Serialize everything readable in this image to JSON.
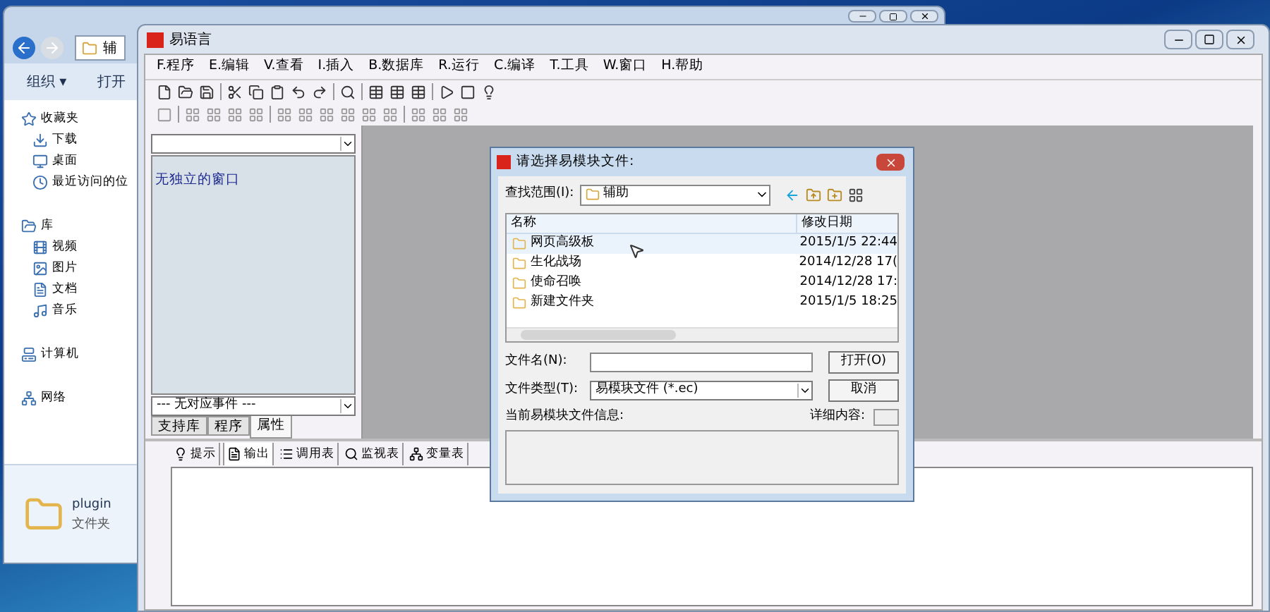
{
  "explorer": {
    "address": "辅",
    "toolbar": [
      "组织 ▾",
      "打开"
    ],
    "nav": [
      {
        "label": "收藏夹",
        "kind": "star"
      },
      {
        "label": "下载",
        "kind": "download"
      },
      {
        "label": "桌面",
        "kind": "desktop"
      },
      {
        "label": "最近访问的位",
        "kind": "recent"
      },
      {
        "label": "库",
        "kind": "library"
      },
      {
        "label": "视频",
        "kind": "video"
      },
      {
        "label": "图片",
        "kind": "picture"
      },
      {
        "label": "文档",
        "kind": "document"
      },
      {
        "label": "音乐",
        "kind": "music"
      },
      {
        "label": "计算机",
        "kind": "computer"
      },
      {
        "label": "网络",
        "kind": "network"
      }
    ],
    "details": {
      "name": "plugin",
      "type": "文件夹"
    }
  },
  "ide": {
    "title": "易语言",
    "menu": [
      "F.程序",
      "E.编辑",
      "V.查看",
      "I.插入",
      "B.数据库",
      "R.运行",
      "C.编译",
      "T.工具",
      "W.窗口",
      "H.帮助"
    ],
    "panel": {
      "list_item": "无独立的窗口",
      "event_combo": "--- 无对应事件 ---",
      "tabs": [
        {
          "label": "支持库",
          "selected": false
        },
        {
          "label": "程序",
          "selected": false
        },
        {
          "label": "属性",
          "selected": true
        }
      ]
    },
    "bottom_tabs": [
      {
        "label": "提示",
        "selected": false
      },
      {
        "label": "输出",
        "selected": true
      },
      {
        "label": "调用表",
        "selected": false
      },
      {
        "label": "监视表",
        "selected": false
      },
      {
        "label": "变量表",
        "selected": false
      }
    ]
  },
  "dialog": {
    "title": "请选择易模块文件:",
    "look_in_label": "查找范围(I):",
    "look_in": "辅助",
    "columns": [
      "名称",
      "修改日期"
    ],
    "rows": [
      {
        "name": "网页高级板",
        "date": "2015/1/5 22:44",
        "selected": true
      },
      {
        "name": "生化战场",
        "date": "2014/12/28 17(",
        "selected": false
      },
      {
        "name": "使命召唤",
        "date": "2014/12/28 17:",
        "selected": false
      },
      {
        "name": "新建文件夹",
        "date": "2015/1/5 18:25",
        "selected": false
      }
    ],
    "filename_label": "文件名(N):",
    "filetype_label": "文件类型(T):",
    "filetype": "易模块文件 (*.ec)",
    "open_button": "打开(O)",
    "cancel_button": "取消",
    "info_label": "当前易模块文件信息:",
    "details_label": "详细内容:"
  }
}
